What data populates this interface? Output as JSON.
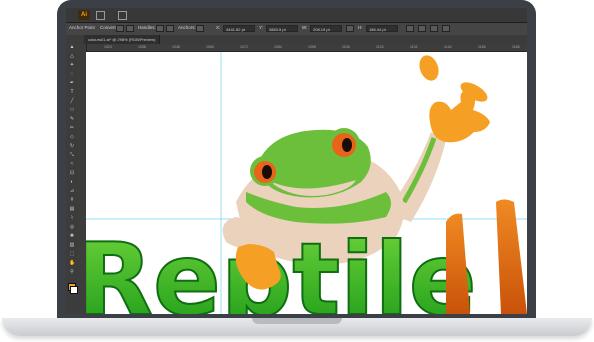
{
  "app": {
    "logo_text": "Ai"
  },
  "control_bar": {
    "selection_label": "Anchor Point",
    "convert_label": "Convert:",
    "handles_label": "Handles:",
    "anchors_label": "Anchors:",
    "x_value": "4441.82 pt",
    "y_value": "3863.5 pt",
    "w_value": "208.19 pt",
    "h_value": "186.44 pt"
  },
  "document_tab": {
    "label": "colours01.ai* @ 298% (RGB/Preview)"
  },
  "ruler_marks": [
    "1024",
    "1036",
    "1048",
    "1060",
    "1072",
    "1084",
    "1096",
    "1108",
    "1120",
    "1132",
    "1144",
    "1156",
    "1168"
  ],
  "artwork": {
    "logo_text": "ReptileH"
  },
  "colors": {
    "frog_green": "#6cbf3b",
    "frog_skin": "#ead2bc",
    "eye_orange": "#e8641b",
    "hand_orange": "#f5a025",
    "text_green": "#2cb21a",
    "text_orange": "#e06a10",
    "guide_cyan": "#6ed6f0"
  }
}
